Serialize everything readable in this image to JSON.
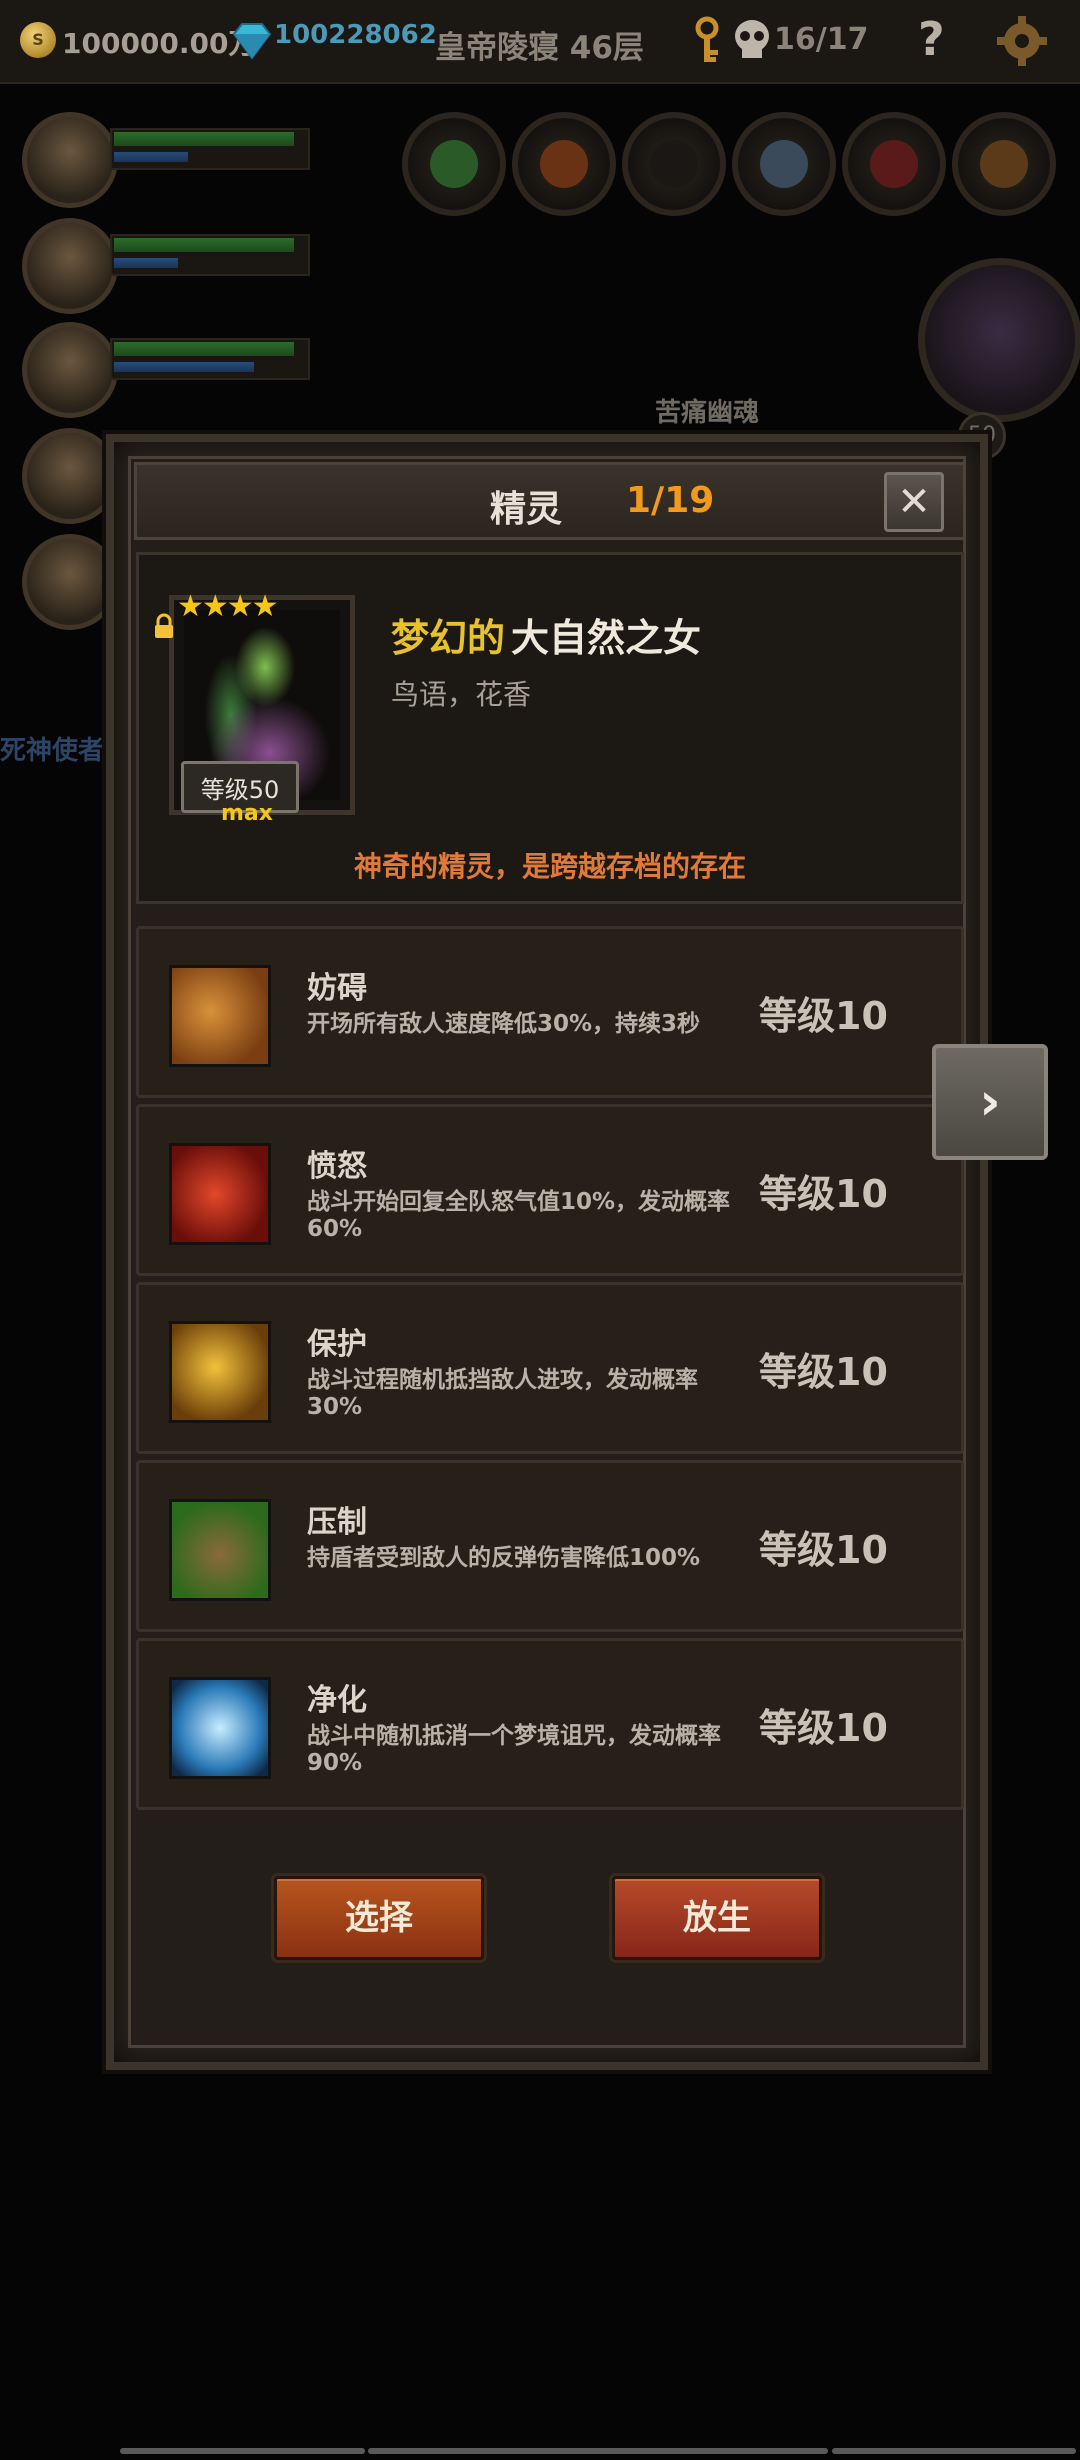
{
  "topbar": {
    "gold": "100000.00万",
    "gems": "100228062",
    "location": "皇帝陵寝 46层",
    "keys_progress": "16/17",
    "help": "?"
  },
  "background": {
    "boss_label": "苦痛幽魂",
    "left_label": "死神使者",
    "boss_badge": "50"
  },
  "panel": {
    "title": "精灵",
    "count": "1/19",
    "close_symbol": "✕",
    "hero": {
      "stars": "★★★★",
      "level_label": "等级50",
      "max_label": "max",
      "name_prefix": "梦幻的",
      "name_main": "大自然之女",
      "subtitle": "鸟语，花香",
      "description": "神奇的精灵，是跨越存档的存在"
    },
    "skills": [
      {
        "name": "妨碍",
        "desc": "开场所有敌人速度降低30%，持续3秒",
        "level": "等级10",
        "icon": "chained-boot-icon",
        "color": "#c9782a"
      },
      {
        "name": "愤怒",
        "desc": "战斗开始回复全队怒气值10%，发动概率60%",
        "level": "等级10",
        "icon": "red-panther-icon",
        "color": "#b42418"
      },
      {
        "name": "保护",
        "desc": "战斗过程随机抵挡敌人进攻，发动概率30%",
        "level": "等级10",
        "icon": "golden-shield-swirl-icon",
        "color": "#d8a020"
      },
      {
        "name": "压制",
        "desc": "持盾者受到敌人的反弹伤害降低100%",
        "level": "等级10",
        "icon": "beast-claw-icon",
        "color": "#5a9a2c"
      },
      {
        "name": "净化",
        "desc": "战斗中随机抵消一个梦境诅咒，发动概率90%",
        "level": "等级10",
        "icon": "blue-flower-icon",
        "color": "#3aa0d8"
      }
    ],
    "buttons": {
      "select": "选择",
      "release": "放生"
    }
  },
  "next_arrow": "›"
}
